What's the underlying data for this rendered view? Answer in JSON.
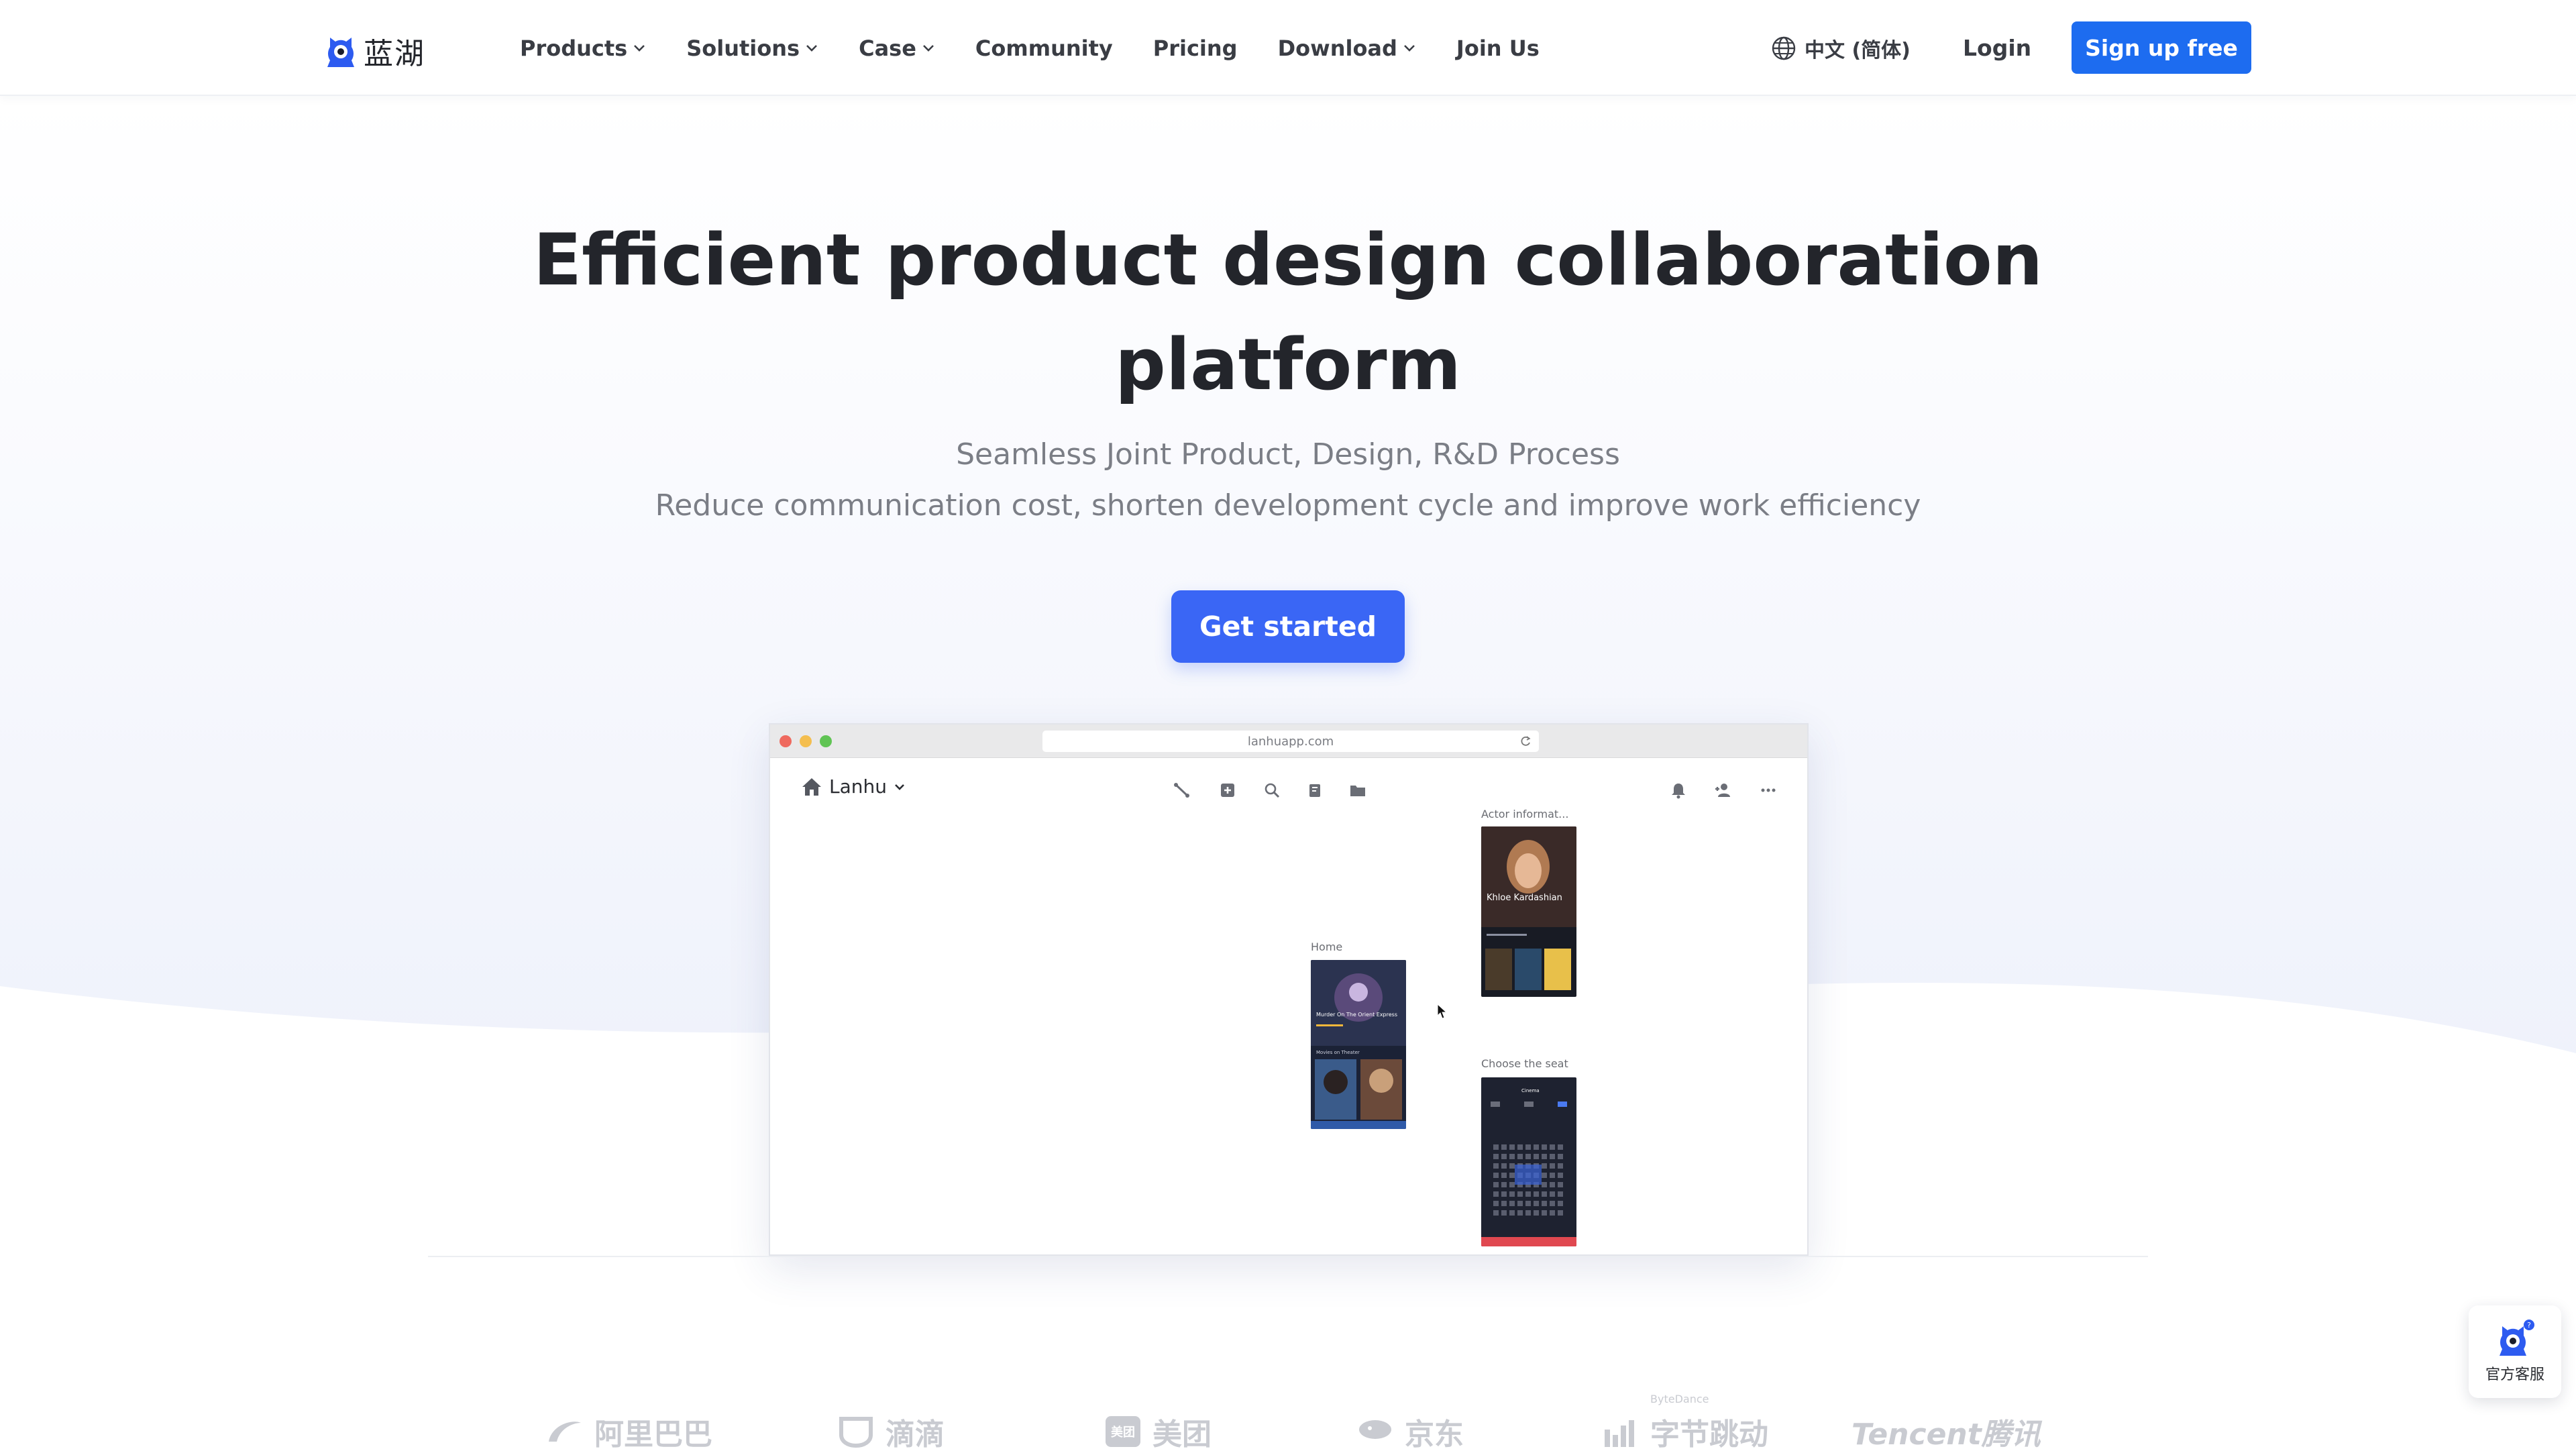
{
  "nav": {
    "logo_text": "蓝湖",
    "items": [
      {
        "label": "Products",
        "dropdown": true
      },
      {
        "label": "Solutions",
        "dropdown": true
      },
      {
        "label": "Case",
        "dropdown": true
      },
      {
        "label": "Community",
        "dropdown": false
      },
      {
        "label": "Pricing",
        "dropdown": false
      },
      {
        "label": "Download",
        "dropdown": true
      },
      {
        "label": "Join Us",
        "dropdown": false
      }
    ],
    "language": "中文 (简体)",
    "login": "Login",
    "signup": "Sign up free"
  },
  "hero": {
    "title_line1": "Efficient product design collaboration",
    "title_line2": "platform",
    "subtitle1": "Seamless Joint Product, Design, R&D Process",
    "subtitle2": "Reduce communication cost, shorten development cycle and improve work efficiency",
    "cta": "Get started"
  },
  "browser": {
    "url": "lanhuapp.com",
    "project_name": "Lanhu",
    "boards": [
      {
        "label": "Home"
      },
      {
        "label": "Actor informat..."
      },
      {
        "label": "Choose the seat"
      }
    ],
    "screen_text": {
      "home_movie": "Murder On The Orient Express",
      "home_section": "Movies on Theater",
      "actor_name": "Khloe Kardashian",
      "seat_title": "Cinema"
    }
  },
  "brands": [
    "阿里巴巴",
    "滴滴",
    "美团",
    "京东",
    "字节跳动",
    "Tencent腾讯"
  ],
  "brand_small": {
    "meituan_mark": "美团",
    "bytedance_top": "ByteDance"
  },
  "support": {
    "label": "官方客服",
    "badge": "?"
  },
  "colors": {
    "primary": "#1d6cf0",
    "cta": "#3a66f5",
    "text": "#23252b",
    "muted": "#7b7e86"
  }
}
